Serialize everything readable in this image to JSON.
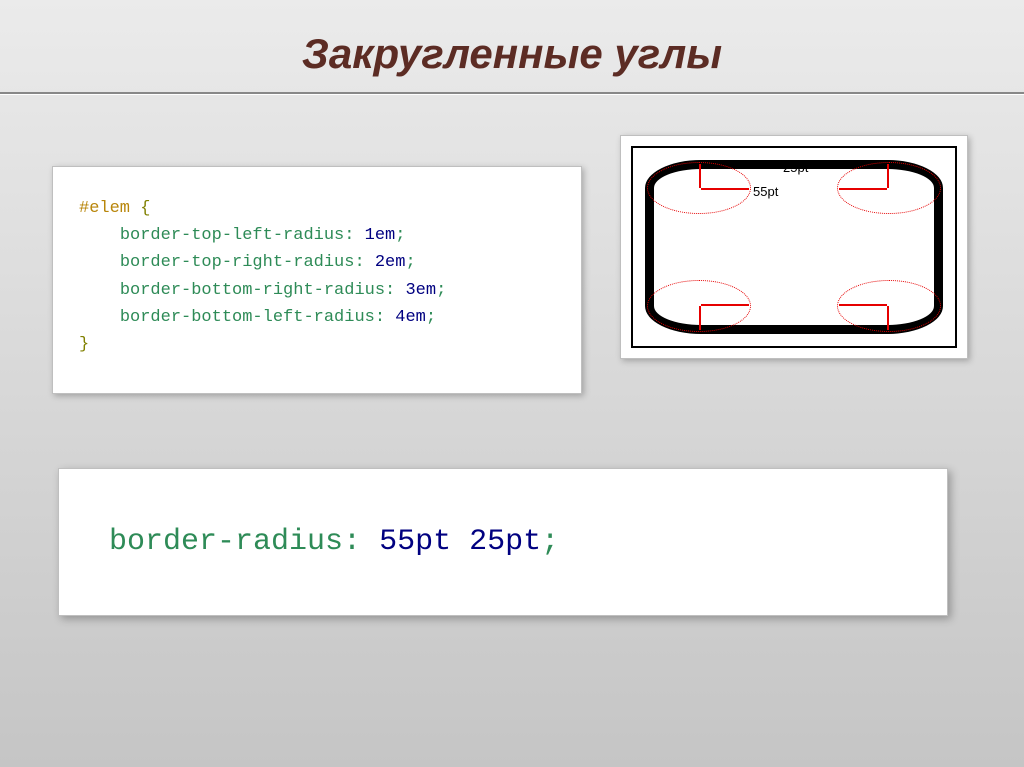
{
  "title": "Закругленные углы",
  "code1": {
    "selector": "#elem",
    "open": "{",
    "l1a": "border-top-left-radius:",
    "l1b": "1em",
    "l2a": "border-top-right-radius:",
    "l2b": "2em",
    "l3a": "border-bottom-right-radius:",
    "l3b": "3em",
    "l4a": "border-bottom-left-radius:",
    "l4b": "4em",
    "semi": ";",
    "close": "}"
  },
  "diagram": {
    "label_v": "25pt",
    "label_h": "55pt"
  },
  "code2": {
    "prop": "border-radius:",
    "val": "55pt 25pt",
    "semi": ";"
  }
}
